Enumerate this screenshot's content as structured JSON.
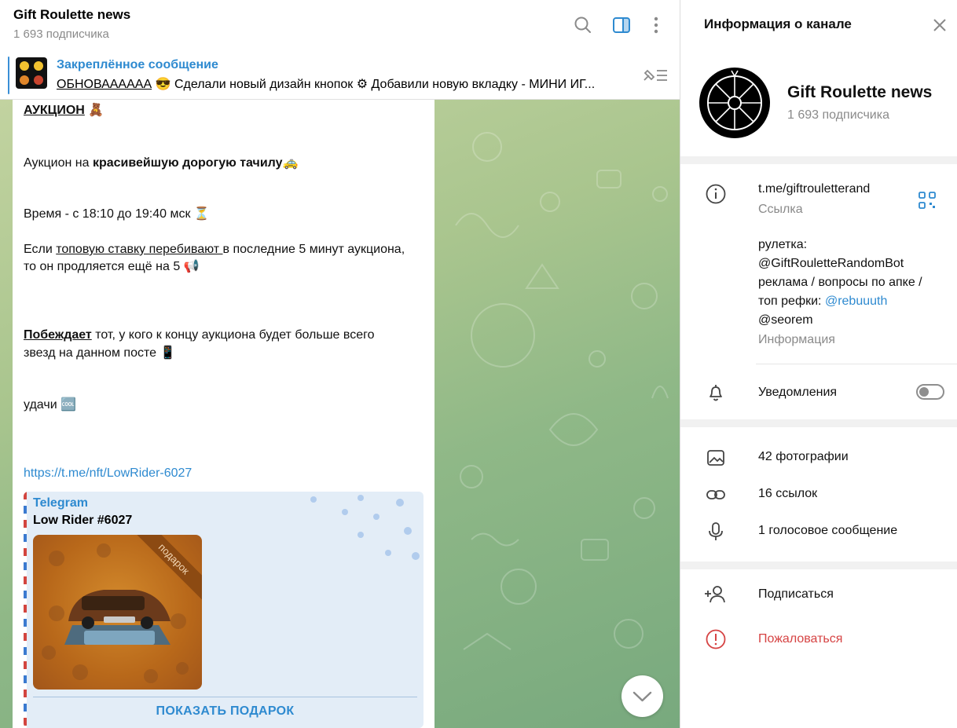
{
  "chat": {
    "title": "Gift Roulette news",
    "subscribers": "1 693 подписчика"
  },
  "icons": {
    "search": "search-icon",
    "sidebar": "sidebar-toggle-icon",
    "more": "more-vertical-icon"
  },
  "pinned": {
    "title": "Закреплённое сообщение",
    "text_underlined": "ОБНОВАААААА",
    "text_rest": " 😎  Сделали новый дизайн кнопок ⚙ Добавили новую вкладку - МИНИ ИГ..."
  },
  "message": {
    "heading": "АУКЦИОН",
    "heading_emoji": "🧸",
    "line1_plain": "Аукцион на ",
    "line1_bold": "красивейшую дорогую тачилу",
    "line1_emoji": "🚕",
    "time": "Время -  с 18:10 до 19:40 мск ⏳",
    "rule_a": "Если ",
    "rule_underline": "топовую ставку перебивают ",
    "rule_b": "в последние 5 минут аукциона,",
    "rule_c": "то он продляется ещё на 5 📢",
    "win_bold": "Побеждает",
    "win_a": " тот, у кого к концу аукциона будет больше всего",
    "win_b": "звезд на данном посте 📱",
    "luck": "удачи 🆒",
    "link": "https://t.me/nft/LowRider-6027",
    "preview": {
      "source": "Telegram",
      "name": "Low Rider #6027",
      "ribbon": "подарок",
      "button": "ПОКАЗАТЬ ПОДАРОК"
    }
  },
  "panel": {
    "title": "Информация о канале",
    "name": "Gift Roulette news",
    "subscribers": "1 693 подписчика",
    "link": "t.me/giftrouletterand",
    "link_label": "Ссылка",
    "desc_line1": "рулетка:",
    "desc_line2": "@GiftRouletteRandomBot",
    "desc_line3": "реклама / вопросы по апке /",
    "desc_line4_a": "топ рефки: ",
    "desc_line4_b": "@rebuuuth",
    "desc_line5": "@seorem",
    "desc_label": "Информация",
    "notifications": "Уведомления",
    "notifications_on": false,
    "photos": "42 фотографии",
    "links": "16 ссылок",
    "voice": "1 голосовое сообщение",
    "subscribe": "Подписаться",
    "report": "Пожаловаться"
  },
  "colors": {
    "accent": "#2e8ad0",
    "danger": "#d64343",
    "muted": "#8a8a8a"
  }
}
